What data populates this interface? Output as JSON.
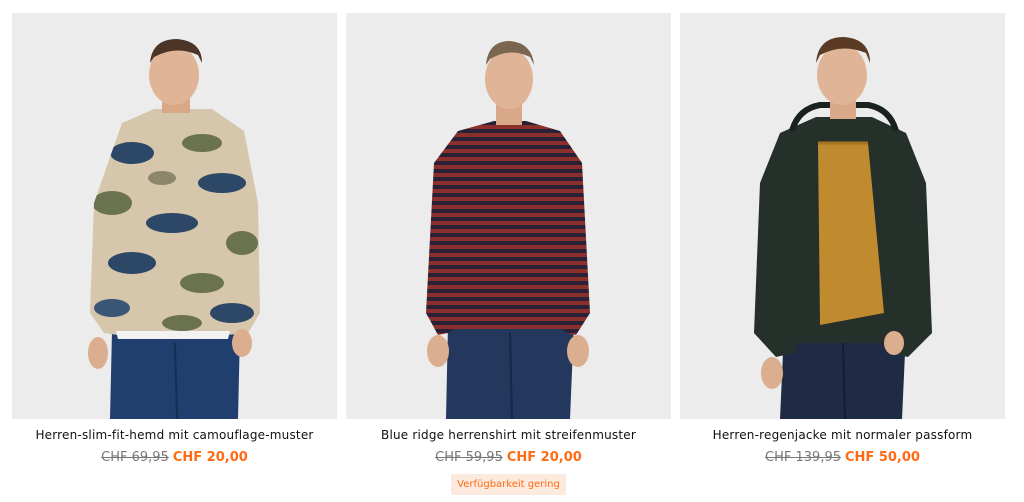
{
  "products": [
    {
      "name": "Herren-slim-fit-hemd mit camouflage-muster",
      "price_old": "CHF 69,95",
      "price_new": "CHF 20,00"
    },
    {
      "name": "Blue ridge herrenshirt mit streifenmuster",
      "price_old": "CHF 59,95",
      "price_new": "CHF 20,00",
      "availability": "Verfügbarkeit gering"
    },
    {
      "name": "Herren-regenjacke mit normaler passform",
      "price_old": "CHF 139,95",
      "price_new": "CHF 50,00"
    }
  ],
  "colors": {
    "image_background": "#ececec",
    "sale_price": "#ff6a13",
    "old_price": "#777777",
    "badge_background": "#fdeadf"
  }
}
